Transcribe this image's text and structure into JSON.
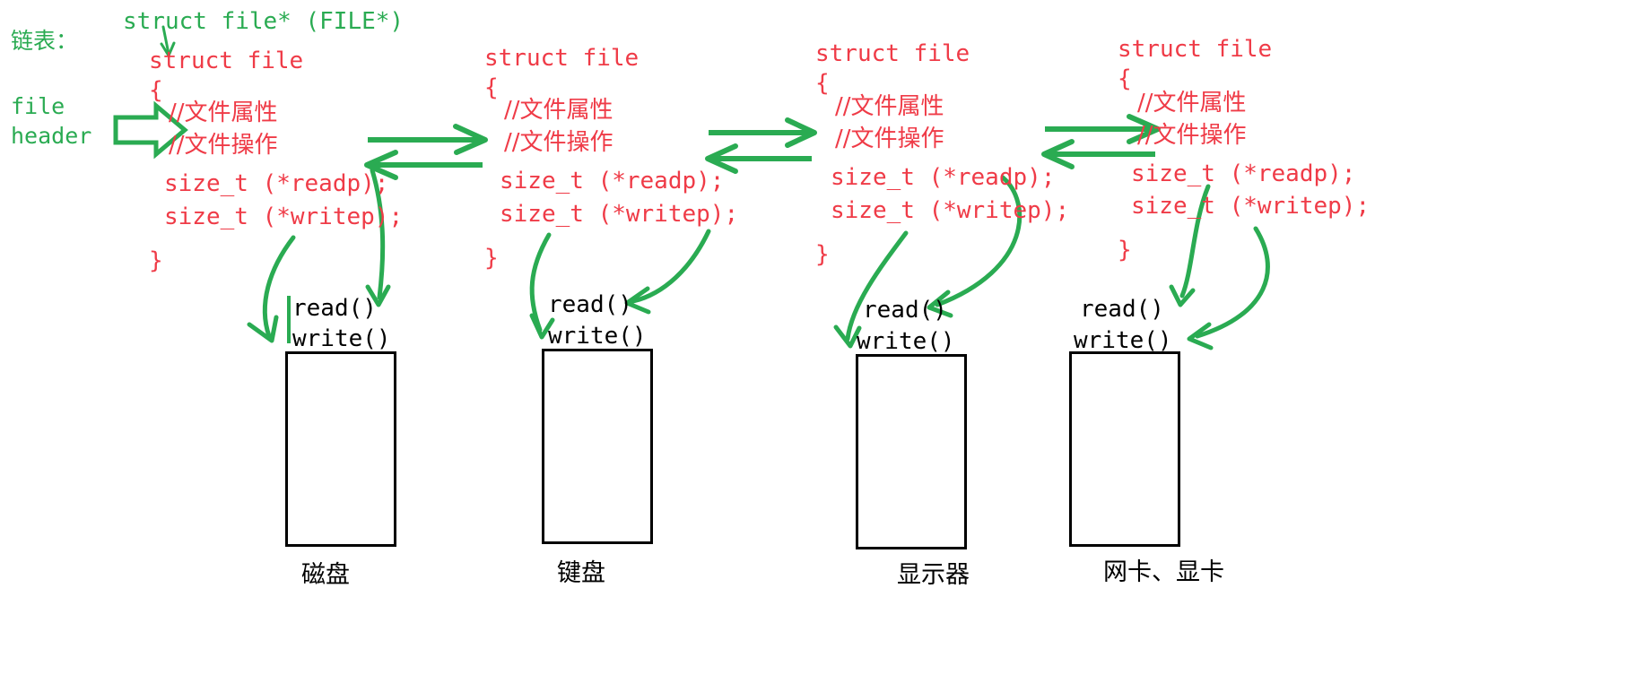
{
  "diagram": {
    "title_label": "链表：",
    "file_header_label_line1": "file",
    "file_header_label_line2": "header",
    "top_annotation": "struct file* (FILE*)",
    "struct_keyword": "struct file",
    "brace_open": "{",
    "brace_close": "}",
    "comment_attr": "//文件属性",
    "comment_ops": "//文件操作",
    "field_readp": "size_t (*readp);",
    "field_writep": "size_t (*writep);",
    "call_read": "read()",
    "call_write": "write()",
    "colors": {
      "green": "#2aab52",
      "red": "#ef3b47",
      "black": "#000000",
      "background": "#ffffff"
    }
  },
  "nodes": [
    {
      "index": 1,
      "struct_keyword": "struct file",
      "brace_open": "{",
      "comment_attr": "//文件属性",
      "comment_ops": "//文件操作",
      "field_readp": "size_t (*readp);",
      "field_writep": "size_t (*writep);",
      "brace_close": "}",
      "call_read": "read()",
      "call_write": "write()",
      "device_label": "磁盘"
    },
    {
      "index": 2,
      "struct_keyword": "struct file",
      "brace_open": "{",
      "comment_attr": "//文件属性",
      "comment_ops": "//文件操作",
      "field_readp": "size_t (*readp);",
      "field_writep": "size_t (*writep);",
      "brace_close": "}",
      "call_read": "read()",
      "call_write": "write()",
      "device_label": "键盘"
    },
    {
      "index": 3,
      "struct_keyword": "struct file",
      "brace_open": "{",
      "comment_attr": "//文件属性",
      "comment_ops": "//文件操作",
      "field_readp": "size_t (*readp);",
      "field_writep": "size_t (*writep);",
      "brace_close": "}",
      "call_read": "read()",
      "call_write": "write()",
      "device_label": "显示器"
    },
    {
      "index": 4,
      "struct_keyword": "struct file",
      "brace_open": "{",
      "comment_attr": "//文件属性",
      "comment_ops": "//文件操作",
      "field_readp": "size_t (*readp);",
      "field_writep": "size_t (*writep);",
      "brace_close": "}",
      "call_read": "read()",
      "call_write": "write()",
      "device_label": "网卡、显卡"
    }
  ]
}
